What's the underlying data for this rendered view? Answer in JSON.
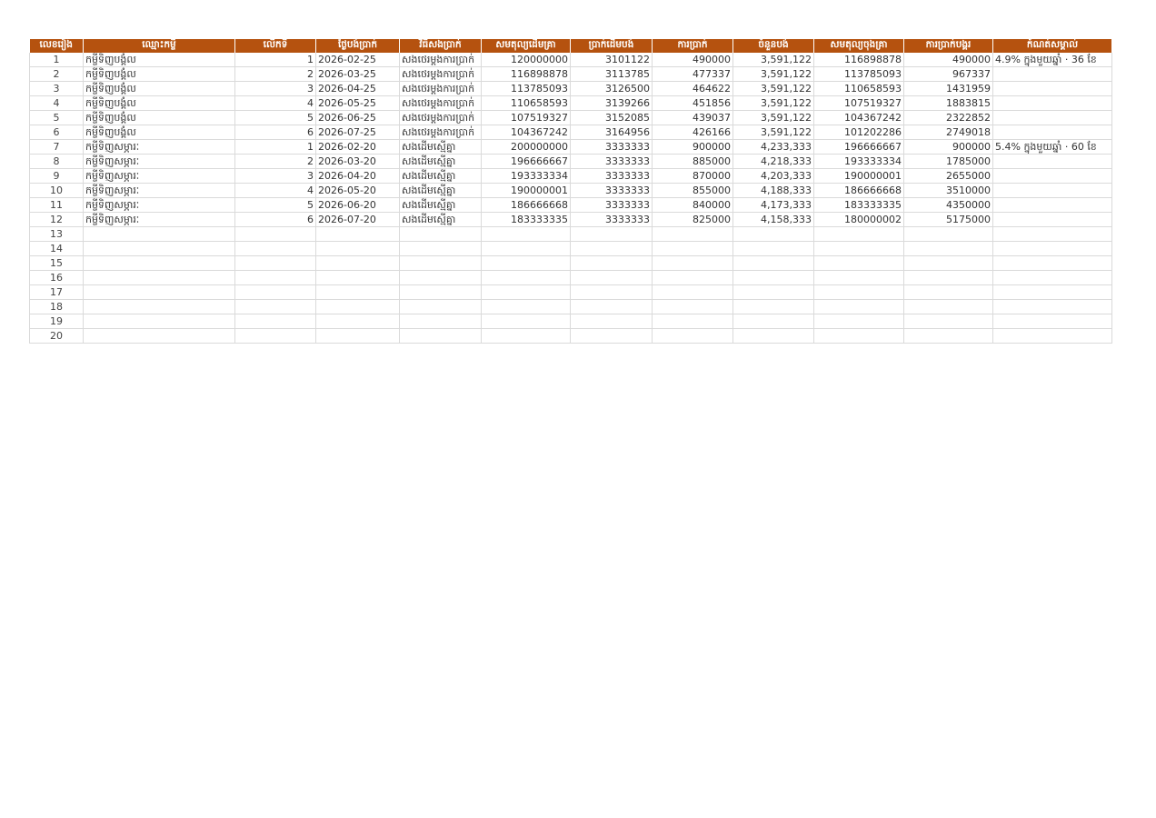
{
  "colors": {
    "header_bg": "#b5520f",
    "header_text": "#ffffff",
    "grid_line": "#dadada"
  },
  "columns": [
    {
      "key": "idx",
      "label": "លេខរៀង"
    },
    {
      "key": "name",
      "label": "ឈ្មោះកម្ចី"
    },
    {
      "key": "time",
      "label": "លើកទី"
    },
    {
      "key": "date",
      "label": "ថ្ងៃបង់ប្រាក់"
    },
    {
      "key": "method",
      "label": "វិធីសងប្រាក់"
    },
    {
      "key": "open",
      "label": "សមតុល្យដើមគ្រា"
    },
    {
      "key": "principal",
      "label": "ប្រាក់ដើមបង់"
    },
    {
      "key": "interest",
      "label": "ការប្រាក់"
    },
    {
      "key": "payment",
      "label": "ចំនួនបង់"
    },
    {
      "key": "close",
      "label": "សមតុល្យចុងគ្រា"
    },
    {
      "key": "cum_interest",
      "label": "ការប្រាក់បង្គរ"
    },
    {
      "key": "note",
      "label": "កំណត់សម្គាល់"
    }
  ],
  "rows": [
    {
      "idx": "1",
      "name": "កម្ចីទិញបង្គំល",
      "time": "1",
      "date": "2026-02-25",
      "method": "សងថេរម្តងការប្រាក់",
      "open": "120000000",
      "principal": "3101122",
      "interest": "490000",
      "payment": "3,591,122",
      "close": "116898878",
      "cum_interest": "490000",
      "note": "4.9% ក្នុងមួយឆ្នាំ · 36 ខែ"
    },
    {
      "idx": "2",
      "name": "កម្ចីទិញបង្គំល",
      "time": "2",
      "date": "2026-03-25",
      "method": "សងថេរម្តងការប្រាក់",
      "open": "116898878",
      "principal": "3113785",
      "interest": "477337",
      "payment": "3,591,122",
      "close": "113785093",
      "cum_interest": "967337",
      "note": ""
    },
    {
      "idx": "3",
      "name": "កម្ចីទិញបង្គំល",
      "time": "3",
      "date": "2026-04-25",
      "method": "សងថេរម្តងការប្រាក់",
      "open": "113785093",
      "principal": "3126500",
      "interest": "464622",
      "payment": "3,591,122",
      "close": "110658593",
      "cum_interest": "1431959",
      "note": ""
    },
    {
      "idx": "4",
      "name": "កម្ចីទិញបង្គំល",
      "time": "4",
      "date": "2026-05-25",
      "method": "សងថេរម្តងការប្រាក់",
      "open": "110658593",
      "principal": "3139266",
      "interest": "451856",
      "payment": "3,591,122",
      "close": "107519327",
      "cum_interest": "1883815",
      "note": ""
    },
    {
      "idx": "5",
      "name": "កម្ចីទិញបង្គំល",
      "time": "5",
      "date": "2026-06-25",
      "method": "សងថេរម្តងការប្រាក់",
      "open": "107519327",
      "principal": "3152085",
      "interest": "439037",
      "payment": "3,591,122",
      "close": "104367242",
      "cum_interest": "2322852",
      "note": ""
    },
    {
      "idx": "6",
      "name": "កម្ចីទិញបង្គំល",
      "time": "6",
      "date": "2026-07-25",
      "method": "សងថេរម្តងការប្រាក់",
      "open": "104367242",
      "principal": "3164956",
      "interest": "426166",
      "payment": "3,591,122",
      "close": "101202286",
      "cum_interest": "2749018",
      "note": ""
    },
    {
      "idx": "7",
      "name": "កម្ចីទិញសម្ភារៈ",
      "time": "1",
      "date": "2026-02-20",
      "method": "សងដើមស្មើគ្នា",
      "open": "200000000",
      "principal": "3333333",
      "interest": "900000",
      "payment": "4,233,333",
      "close": "196666667",
      "cum_interest": "900000",
      "note": "5.4% ក្នុងមួយឆ្នាំ · 60 ខែ"
    },
    {
      "idx": "8",
      "name": "កម្ចីទិញសម្ភារៈ",
      "time": "2",
      "date": "2026-03-20",
      "method": "សងដើមស្មើគ្នា",
      "open": "196666667",
      "principal": "3333333",
      "interest": "885000",
      "payment": "4,218,333",
      "close": "193333334",
      "cum_interest": "1785000",
      "note": ""
    },
    {
      "idx": "9",
      "name": "កម្ចីទិញសម្ភារៈ",
      "time": "3",
      "date": "2026-04-20",
      "method": "សងដើមស្មើគ្នា",
      "open": "193333334",
      "principal": "3333333",
      "interest": "870000",
      "payment": "4,203,333",
      "close": "190000001",
      "cum_interest": "2655000",
      "note": ""
    },
    {
      "idx": "10",
      "name": "កម្ចីទិញសម្ភារៈ",
      "time": "4",
      "date": "2026-05-20",
      "method": "សងដើមស្មើគ្នា",
      "open": "190000001",
      "principal": "3333333",
      "interest": "855000",
      "payment": "4,188,333",
      "close": "186666668",
      "cum_interest": "3510000",
      "note": ""
    },
    {
      "idx": "11",
      "name": "កម្ចីទិញសម្ភារៈ",
      "time": "5",
      "date": "2026-06-20",
      "method": "សងដើមស្មើគ្នា",
      "open": "186666668",
      "principal": "3333333",
      "interest": "840000",
      "payment": "4,173,333",
      "close": "183333335",
      "cum_interest": "4350000",
      "note": ""
    },
    {
      "idx": "12",
      "name": "កម្ចីទិញសម្ភារៈ",
      "time": "6",
      "date": "2026-07-20",
      "method": "សងដើមស្មើគ្នា",
      "open": "183333335",
      "principal": "3333333",
      "interest": "825000",
      "payment": "4,158,333",
      "close": "180000002",
      "cum_interest": "5175000",
      "note": ""
    },
    {
      "idx": "13"
    },
    {
      "idx": "14"
    },
    {
      "idx": "15"
    },
    {
      "idx": "16"
    },
    {
      "idx": "17"
    },
    {
      "idx": "18"
    },
    {
      "idx": "19"
    },
    {
      "idx": "20"
    }
  ]
}
